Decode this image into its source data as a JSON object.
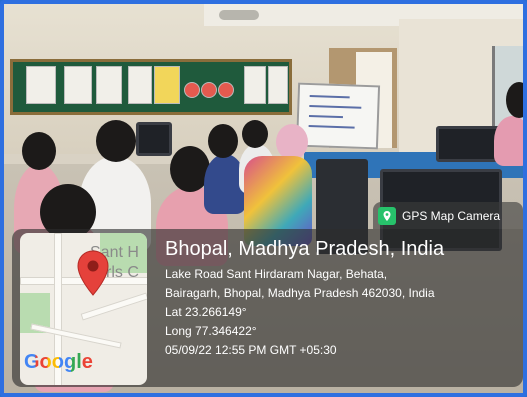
{
  "badge": {
    "label": "GPS Map Camera",
    "icon": "gps-camera-icon"
  },
  "map": {
    "label_lines": [
      "Sant H",
      "Girls C"
    ],
    "brand": "Google",
    "icon": "location-pin-icon"
  },
  "location": {
    "title": "Bhopal, Madhya Pradesh, India",
    "address_line1": "Lake Road Sant Hirdaram Nagar, Behata,",
    "address_line2": "Bairagarh, Bhopal, Madhya Pradesh 462030, India",
    "latitude": "Lat 23.266149°",
    "longitude": "Long 77.346422°",
    "timestamp": "05/09/22 12:55 PM GMT +05:30"
  },
  "colors": {
    "frame": "#2e6fe0",
    "pin": "#e5413b",
    "badge_icon": "#27c26b"
  }
}
